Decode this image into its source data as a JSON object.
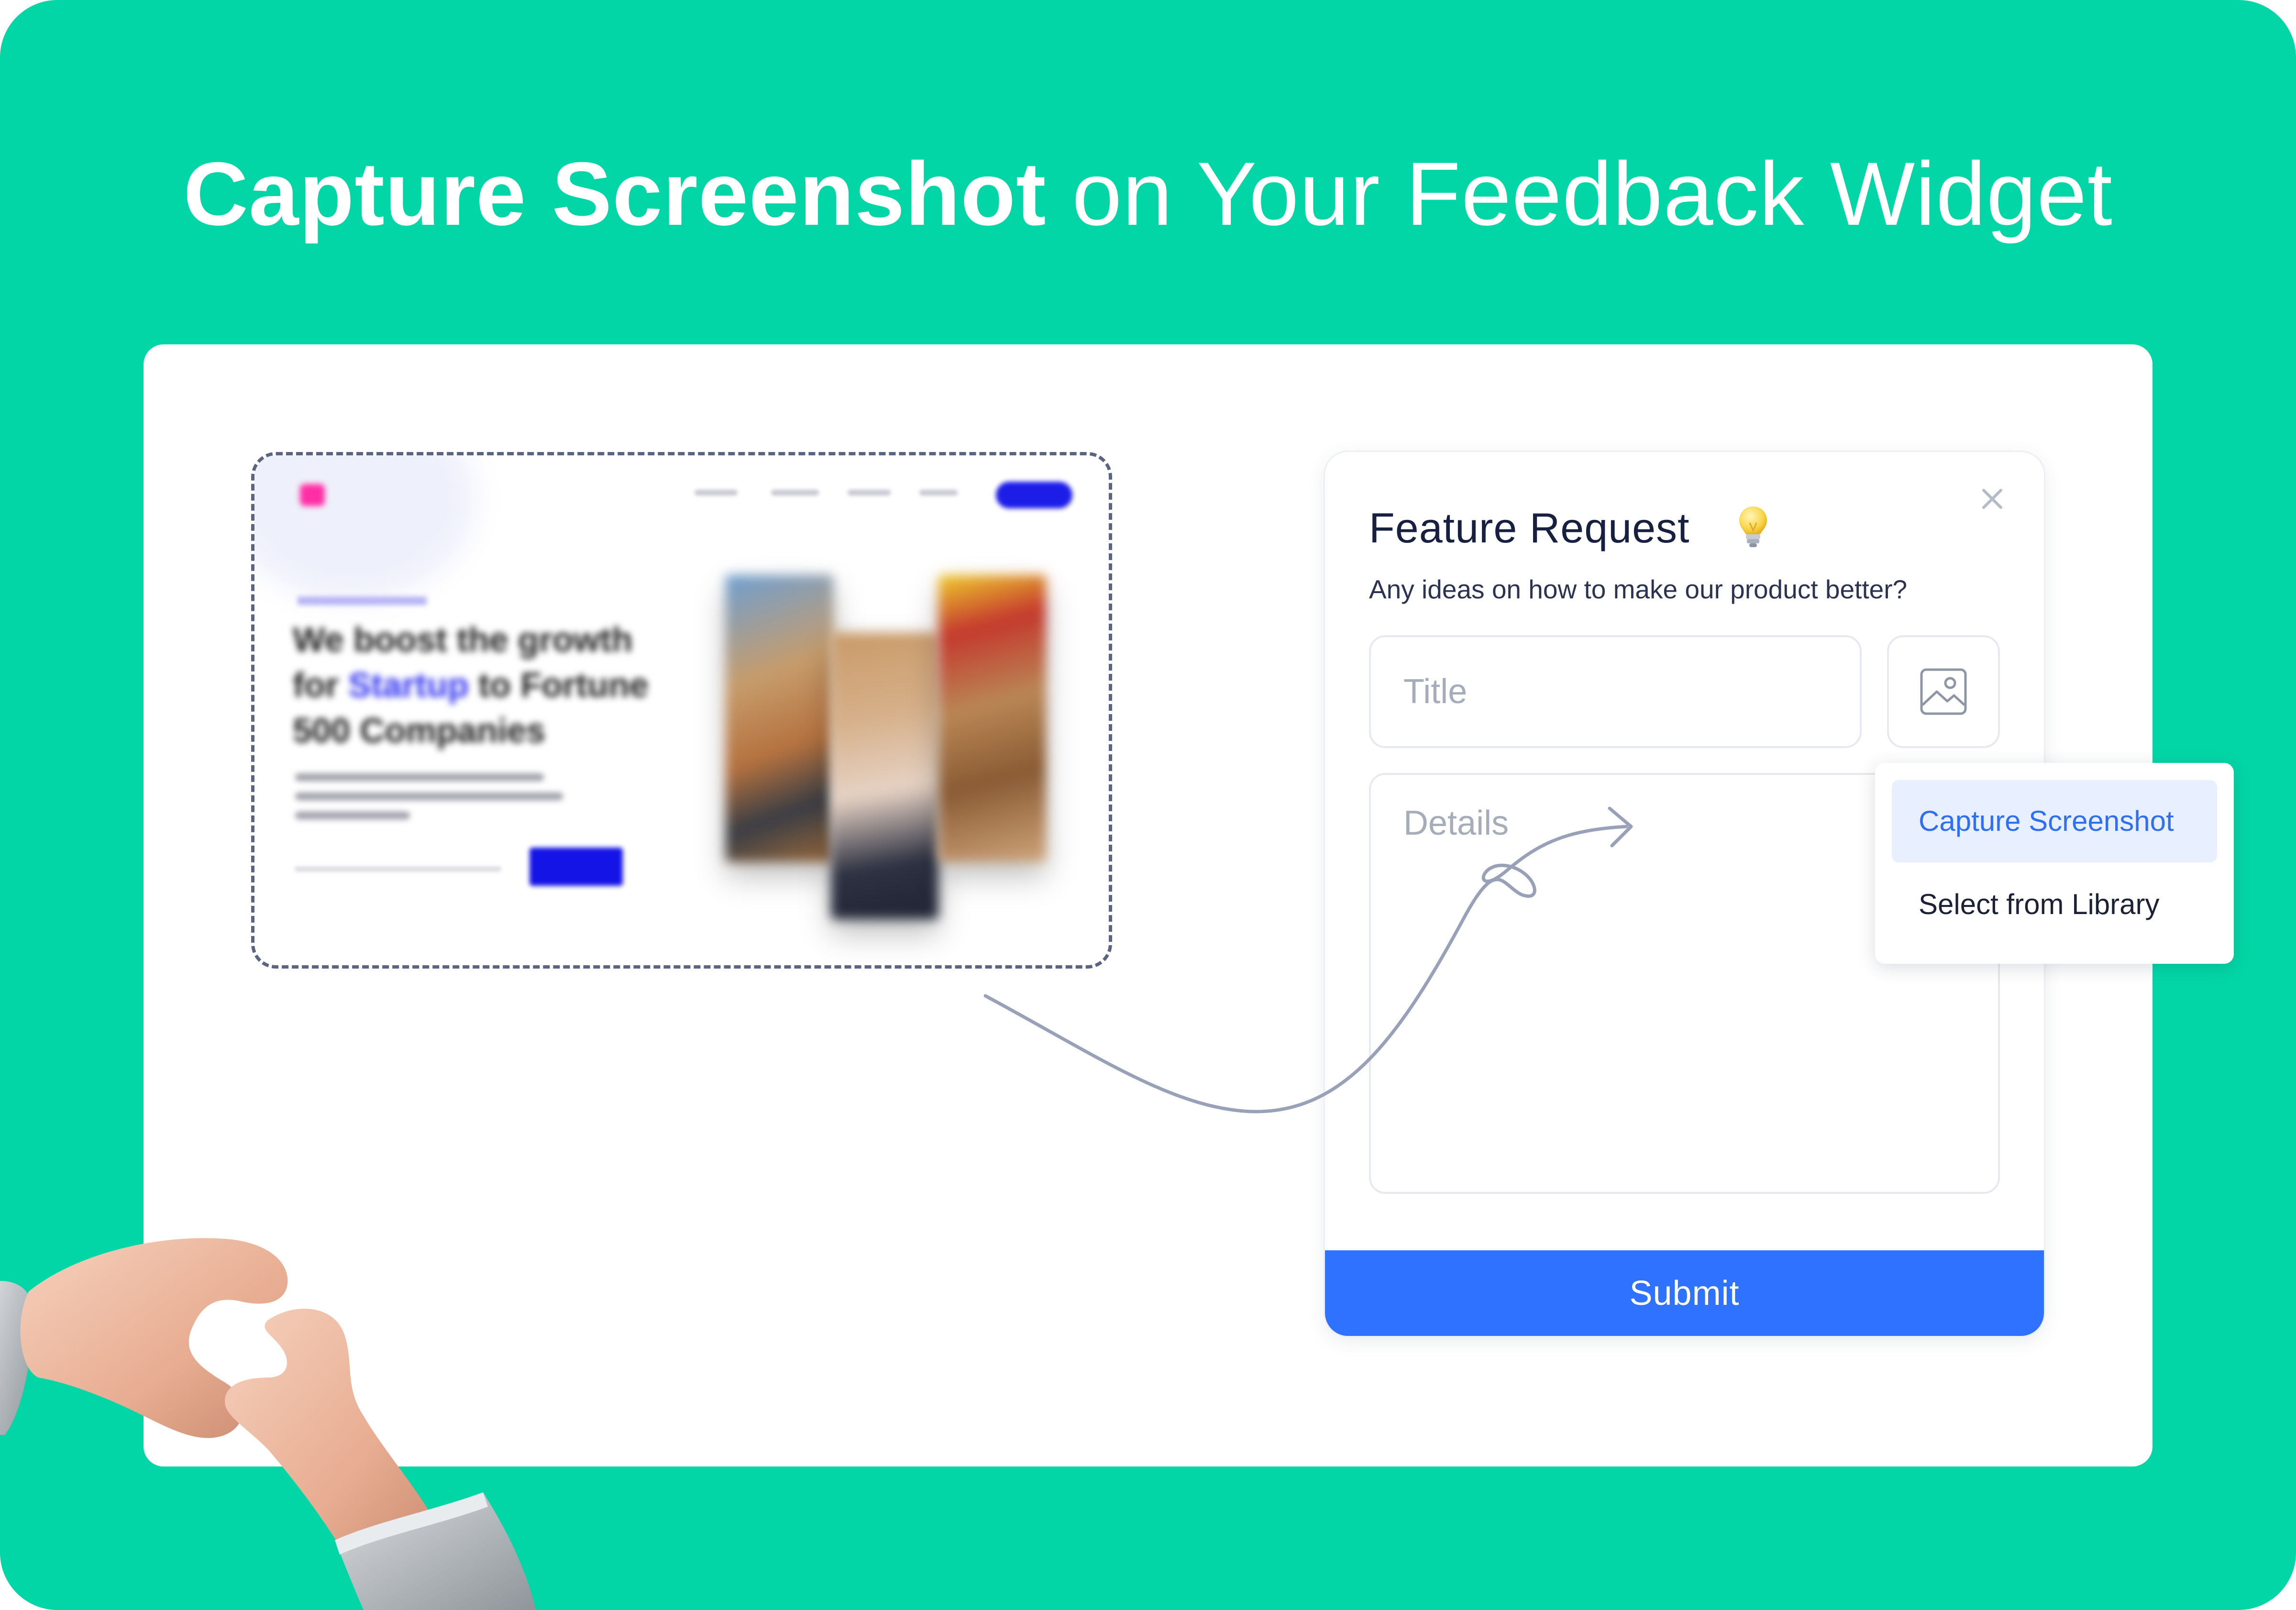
{
  "headline": {
    "bold": "Capture Screenshot",
    "light": "on Your Feedback Widget"
  },
  "preview": {
    "hero_line_1": "We boost the growth",
    "hero_line_2_prefix": "for ",
    "hero_line_2_highlight": "Startup",
    "hero_line_2_suffix": " to Fortune",
    "hero_line_3": "500 Companies"
  },
  "widget": {
    "title": "Feature Request",
    "subtitle": "Any ideas on how to make our product better?",
    "title_placeholder": "Title",
    "details_placeholder": "Details",
    "submit_label": "Submit",
    "menu": {
      "capture_label": "Capture Screenshot",
      "library_label": "Select from Library"
    }
  },
  "colors": {
    "background": "#03d6a6",
    "accent": "#2f72ff",
    "menu_active_bg": "#e8efff",
    "menu_active_text": "#2f6ff0"
  },
  "icons": {
    "close": "close-icon",
    "image": "image-icon",
    "bulb": "lightbulb-icon"
  }
}
